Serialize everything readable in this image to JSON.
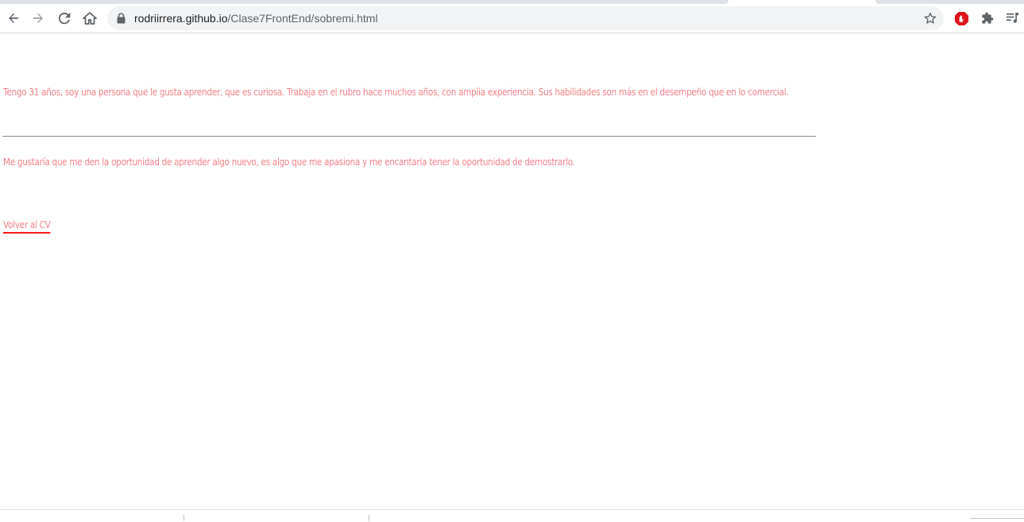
{
  "browser": {
    "url_host": "rodriirrera.github.io",
    "url_path": "/Clase7FrontEnd/sobremi.html",
    "icons": {
      "back": "arrow-left-icon",
      "forward": "arrow-right-icon",
      "reload": "reload-icon",
      "home": "home-icon",
      "lock": "lock-icon",
      "bookmark": "star-icon",
      "opera_ext": "stop-sign-icon",
      "extensions": "puzzle-icon",
      "media": "playlist-icon"
    }
  },
  "page": {
    "paragraph_1": "Tengo 31 años, soy una persona que le gusta aprender, que es curiosa. Trabaja en el rubro hace muchos años, con amplia experiencia. Sus habilidades son más en el desempeño que en lo comercial.",
    "paragraph_2": "Me gustaría que me den la oportunidad de aprender algo nuevo, es algo que me apasiona y me encantaría tener la oportunidad de demostrarlo.",
    "back_link": "Volver al CV"
  },
  "colors": {
    "text": "#f4838a",
    "link_underline": "#ff1a1a",
    "rule": "#8a8a8a"
  }
}
